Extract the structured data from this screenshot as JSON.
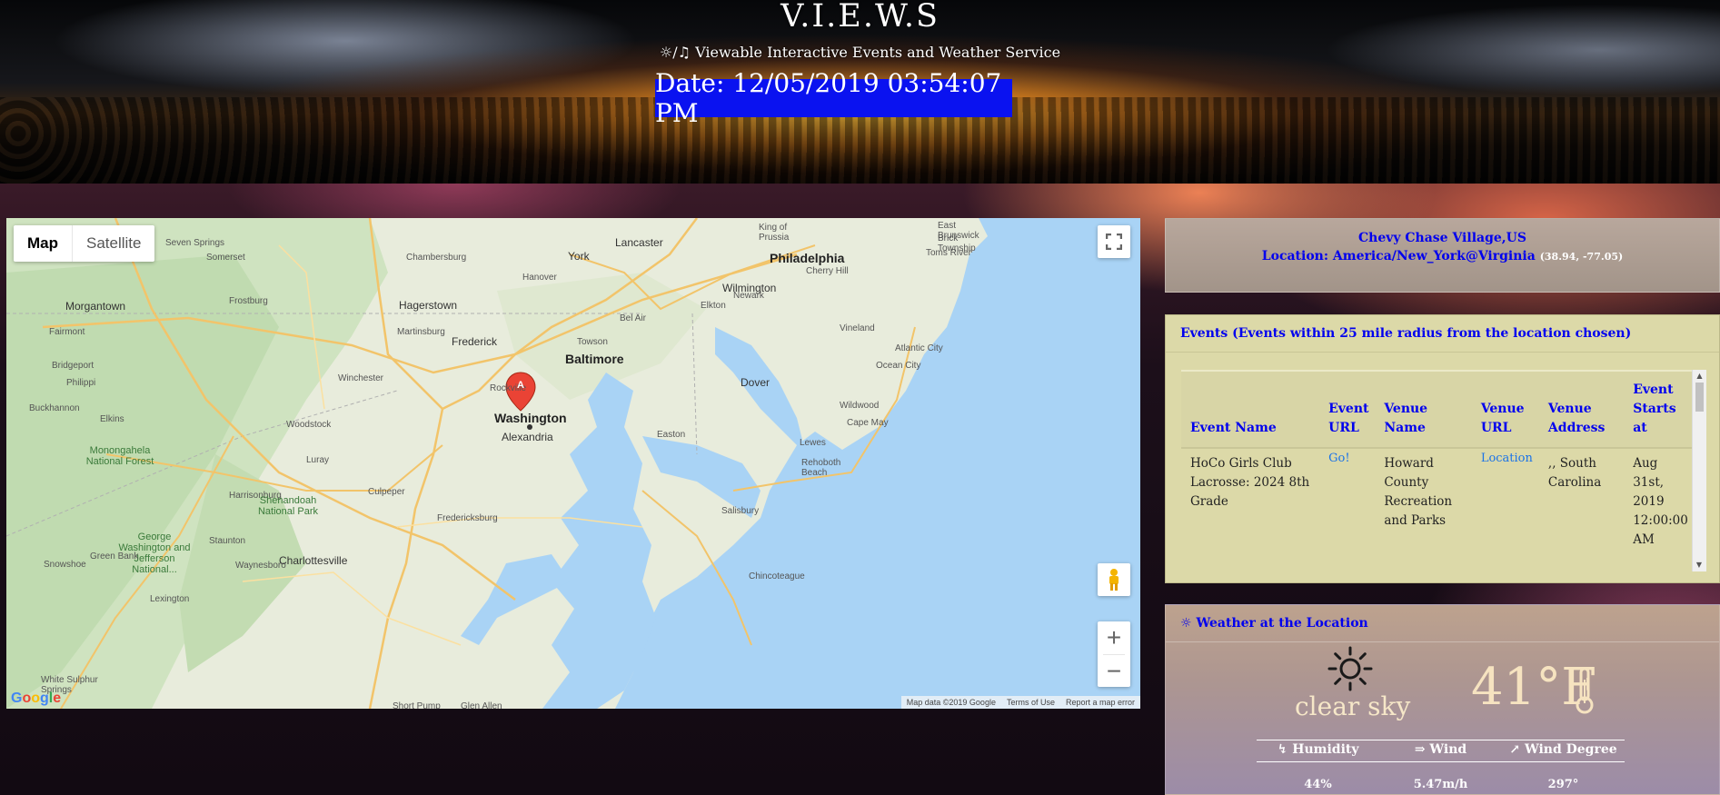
{
  "header": {
    "title": "V.I.E.W.S",
    "subtitle_icons": "☼/♫",
    "subtitle": "Viewable Interactive Events and Weather Service",
    "date_label": "Date: 12/05/2019 03:54:07 PM"
  },
  "map": {
    "type_tabs": [
      "Map",
      "Satellite"
    ],
    "active_tab": "Map",
    "marker_label": "A",
    "footer": {
      "data": "Map data ©2019 Google",
      "terms": "Terms of Use",
      "report": "Report a map error"
    },
    "logo": "Google",
    "cities": {
      "philadelphia": "Philadelphia",
      "baltimore": "Baltimore",
      "washington": "Washington",
      "alexandria": "Alexandria",
      "york": "York",
      "lancaster": "Lancaster",
      "wilmington": "Wilmington",
      "dover": "Dover",
      "hagerstown": "Hagerstown",
      "frederick": "Frederick",
      "rockville": "Rockville",
      "towson": "Towson",
      "chambersburg": "Chambersburg",
      "morgantown": "Morgantown",
      "winchester": "Winchester",
      "charlottesville": "Charlottesville",
      "harrisonburg": "Harrisonburg",
      "culpeper": "Culpeper",
      "fredericksburg": "Fredericksburg",
      "atlantic_city": "Atlantic City",
      "vineland": "Vineland",
      "cherry_hill": "Cherry Hill",
      "toms_river": "Toms River",
      "ocean_city": "Ocean City",
      "salisbury": "Salisbury",
      "easton": "Easton",
      "rehoboth": "Rehoboth Beach",
      "lewes": "Lewes",
      "cape_may": "Cape May",
      "wildwood": "Wildwood",
      "shenandoah": "Shenandoah National Park",
      "monongahela": "Monongahela National Forest",
      "gw_forest": "George Washington and Jefferson National...",
      "elkton": "Elkton",
      "newark": "Newark",
      "bel_air": "Bel Air",
      "hanover": "Hanover",
      "frostburg": "Frostburg",
      "martinsburg": "Martinsburg",
      "woodstock": "Woodstock",
      "luray": "Luray",
      "staunton": "Staunton",
      "waynesboro": "Waynesboro",
      "lexington": "Lexington",
      "elkins": "Elkins",
      "buckhannon": "Buckhannon",
      "philippi": "Philippi",
      "bridgeport": "Bridgeport",
      "fairmont": "Fairmont",
      "somerset": "Somerset",
      "seven_springs": "Seven Springs",
      "chincoteague": "Chincoteague",
      "king_of_prussia": "King of\nPrussia",
      "east_brunswick": "East\nBrunswick",
      "brick_township": "Brick\nTownship",
      "short_pump": "Short Pump",
      "glen_allen": "Glen Allen",
      "white_sulphur": "White Sulphur\nSprings",
      "green_bank": "Green Bank",
      "snowshoe": "Snowshoe"
    }
  },
  "location": {
    "place": "Chevy Chase Village,US",
    "location_label": "Location: America/New_York@Virginia",
    "coords": "(38.94, -77.05)"
  },
  "events": {
    "heading": "Events (Events within 25 mile radius from the location chosen)",
    "columns": [
      "Event Name",
      "Event URL",
      "Venue Name",
      "Venue URL",
      "Venue Address",
      "Event Starts at"
    ],
    "rows": [
      {
        "name": "HoCo Girls Club Lacrosse: 2024 8th Grade",
        "url_label": "Go!",
        "venue": "Howard County Recreation and Parks",
        "venue_url_label": "Location",
        "address": ",, South Carolina",
        "starts": "Aug 31st, 2019 12:00:00 AM"
      }
    ]
  },
  "weather": {
    "heading_icon": "☼",
    "heading": "Weather at the Location",
    "condition": "clear sky",
    "temperature": "41°F",
    "labels": {
      "humidity": "Humidity",
      "wind": "Wind",
      "wind_degree": "Wind Degree"
    },
    "label_icons": {
      "humidity": "↯",
      "wind": "⇒",
      "wind_degree": "↗"
    },
    "values": {
      "humidity": "44%",
      "wind": "5.47m/h",
      "wind_degree": "297°"
    }
  },
  "colors": {
    "link_blue": "#0000ee",
    "date_bg": "#0a12f0",
    "events_bg": "#dcd9a8",
    "map_water": "#a9d3f5"
  }
}
